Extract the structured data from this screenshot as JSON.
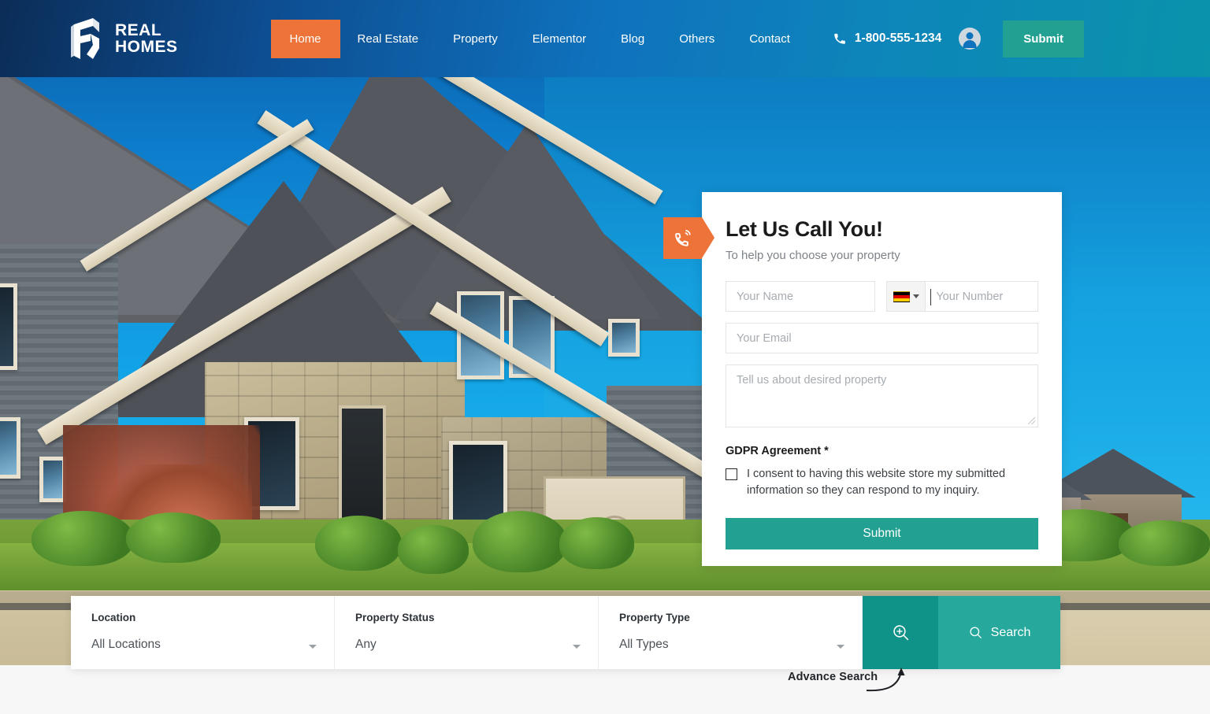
{
  "header": {
    "logo": {
      "line1": "REAL",
      "line2": "HOMES",
      "icon": "real-homes-logo"
    },
    "nav": [
      {
        "label": "Home",
        "active": true
      },
      {
        "label": "Real Estate",
        "active": false
      },
      {
        "label": "Property",
        "active": false
      },
      {
        "label": "Elementor",
        "active": false
      },
      {
        "label": "Blog",
        "active": false
      },
      {
        "label": "Others",
        "active": false
      },
      {
        "label": "Contact",
        "active": false
      }
    ],
    "phone": "1-800-555-1234",
    "phone_icon": "phone-icon",
    "account_icon": "user-account-icon",
    "submit_label": "Submit",
    "accent_orange": "#ee7338",
    "accent_teal": "#22a193"
  },
  "call_form": {
    "badge_icon": "phone-ringing-icon",
    "title": "Let Us Call You!",
    "subtitle": "To help you choose your property",
    "name_placeholder": "Your Name",
    "country_flag": "germany-flag",
    "number_placeholder": "Your Number",
    "email_placeholder": "Your Email",
    "message_placeholder": "Tell us about desired property",
    "gdpr_title": "GDPR Agreement *",
    "gdpr_consent": "I consent to having this website store my submitted information so they can respond to my inquiry.",
    "submit_label": "Submit"
  },
  "search": {
    "fields": [
      {
        "label": "Location",
        "value": "All Locations"
      },
      {
        "label": "Property Status",
        "value": "Any"
      },
      {
        "label": "Property Type",
        "value": "All Types"
      }
    ],
    "advance_icon": "magnifier-plus-icon",
    "search_icon": "search-icon",
    "search_label": "Search"
  },
  "annotation": {
    "label": "Advance Search",
    "arrow": "curved-arrow-up-icon"
  }
}
